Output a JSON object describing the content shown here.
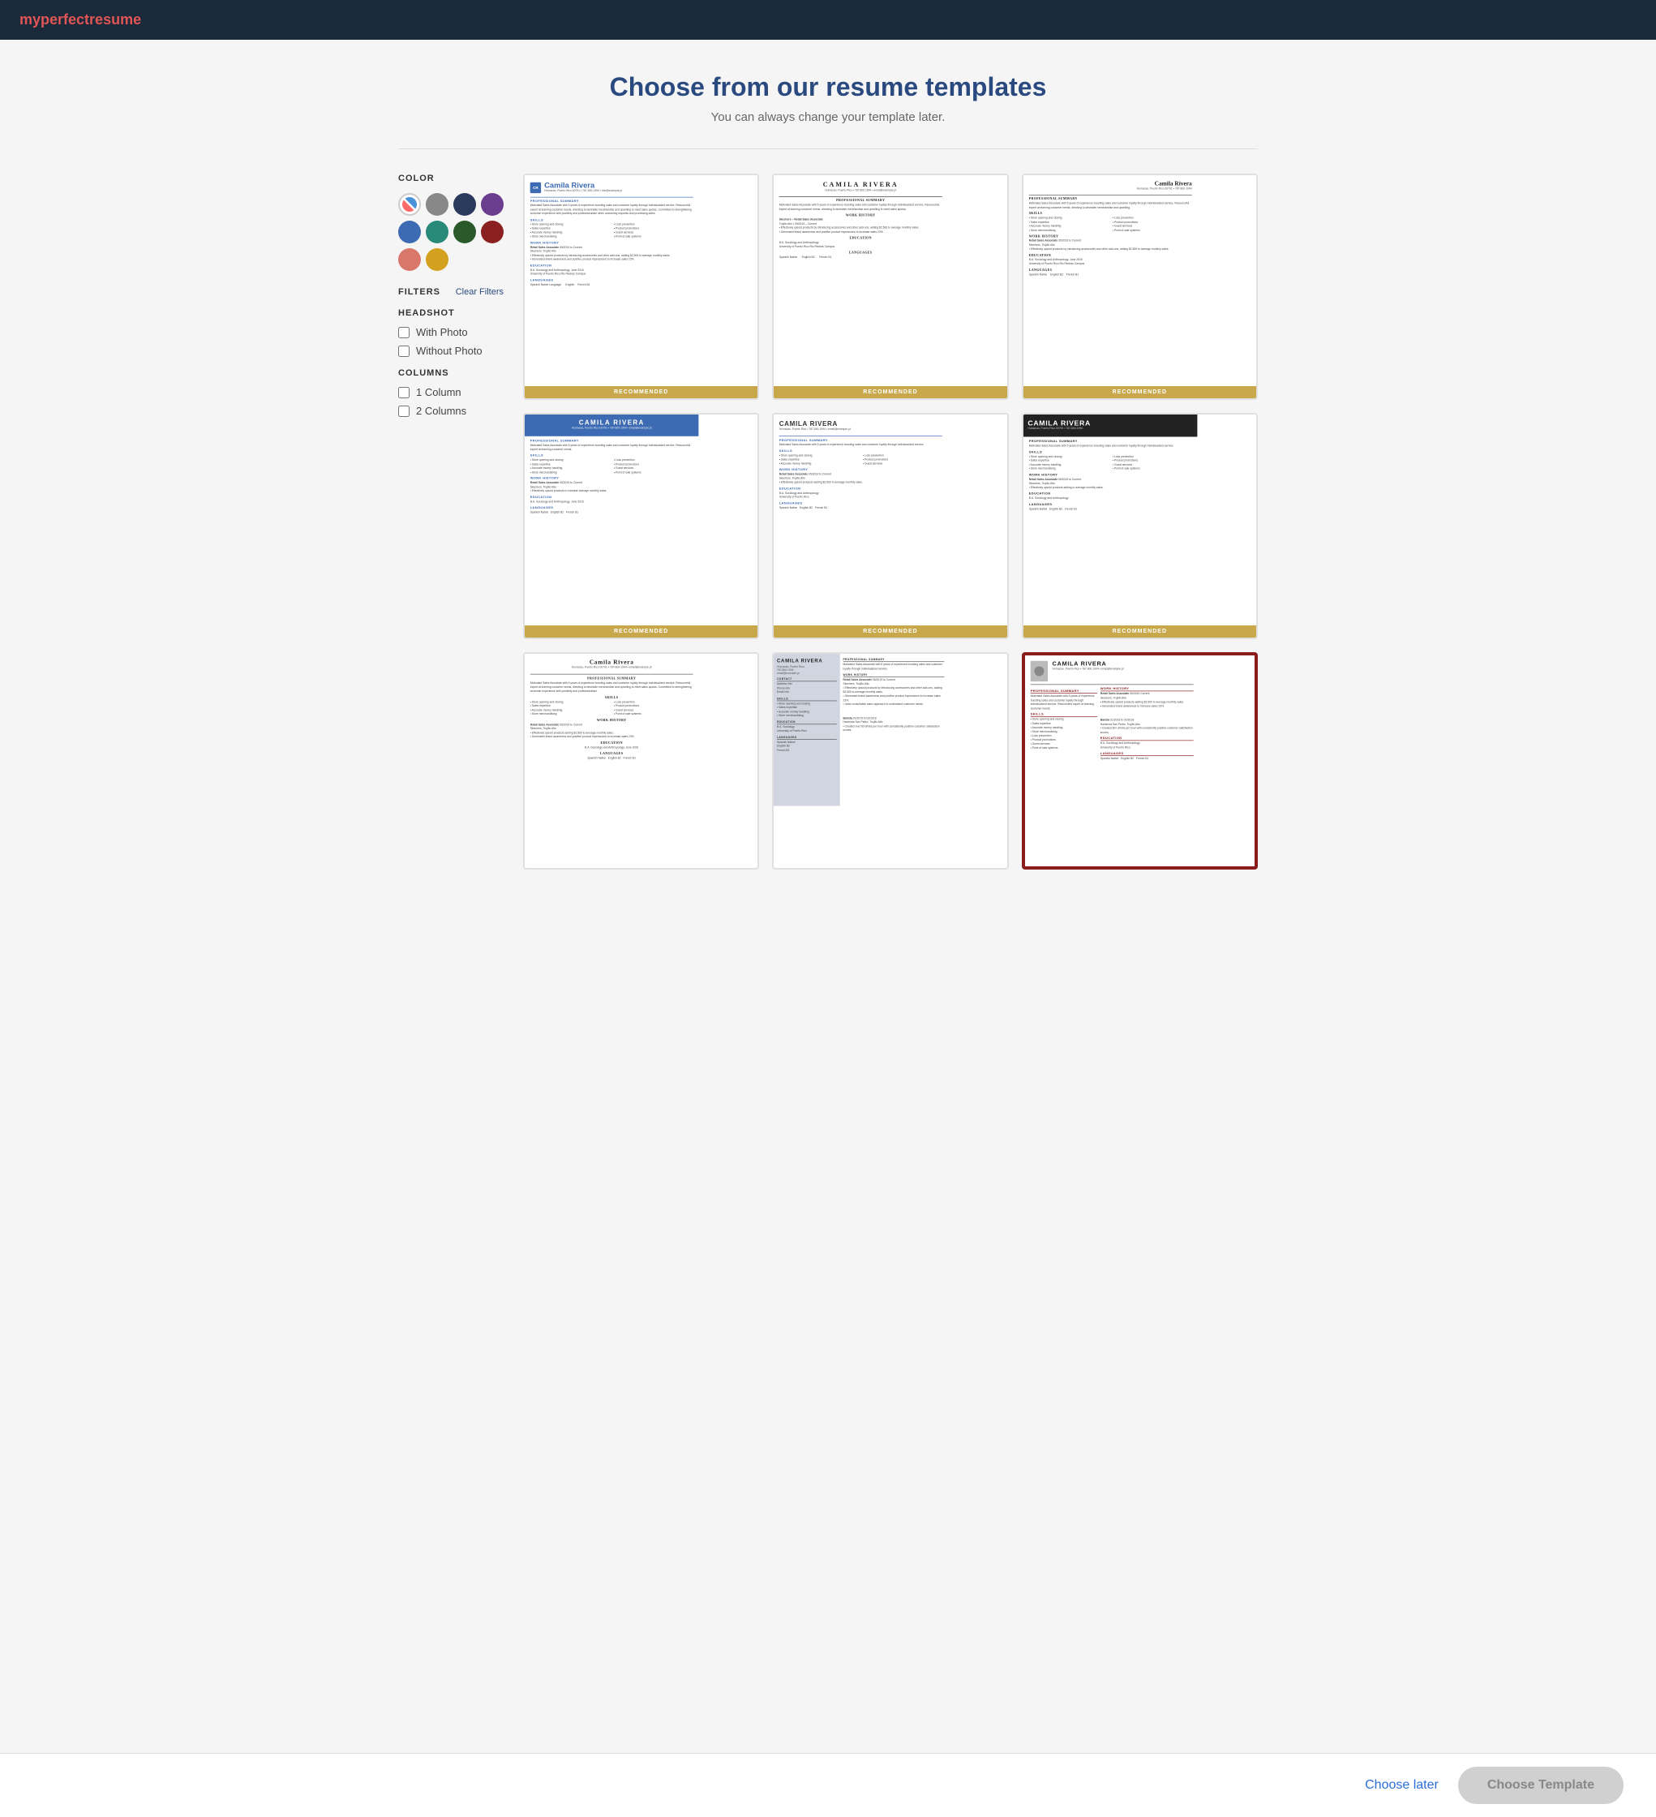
{
  "header": {
    "logo_prefix": "my",
    "logo_highlight": "perfect",
    "logo_suffix": "resume"
  },
  "page": {
    "title": "Choose from our resume templates",
    "subtitle": "You can always change your template later."
  },
  "sidebar": {
    "color_section_title": "COLOR",
    "filters_title": "FILTERS",
    "clear_filters_label": "Clear Filters",
    "headshot_title": "HEADSHOT",
    "with_photo_label": "With Photo",
    "without_photo_label": "Without Photo",
    "columns_title": "COLUMNS",
    "one_column_label": "1 Column",
    "two_columns_label": "2 Columns",
    "colors": [
      {
        "id": "rainbow",
        "value": "rainbow",
        "selected": true
      },
      {
        "id": "gray",
        "value": "#888888"
      },
      {
        "id": "darkblue",
        "value": "#2a3a5c"
      },
      {
        "id": "purple",
        "value": "#6b3d8f"
      },
      {
        "id": "blue",
        "value": "#3d6bb3"
      },
      {
        "id": "teal",
        "value": "#2a8a7a"
      },
      {
        "id": "darkgreen",
        "value": "#2a5a2a"
      },
      {
        "id": "darkred",
        "value": "#8b2020"
      },
      {
        "id": "salmon",
        "value": "#d9776a"
      },
      {
        "id": "gold",
        "value": "#d4a020"
      }
    ]
  },
  "templates": [
    {
      "id": 1,
      "style": "blue-left-accent",
      "recommended": true,
      "name": "Camila Rivera",
      "contact": "Humacao, Puerto Rico 00791 | 787-800-1994 | e: info@example.pt",
      "has_photo": false,
      "columns": 1
    },
    {
      "id": 2,
      "style": "centered-serif",
      "recommended": true,
      "name": "CAMILA RIVERA",
      "contact": "Humacao, Puerto Rico | 787.800.1994 | email@example.pt",
      "has_photo": false,
      "columns": 1
    },
    {
      "id": 3,
      "style": "classic-right",
      "recommended": true,
      "name": "Camila Rivera",
      "contact": "Humacao, Puerto Rico 00791 | 787-800-1994",
      "has_photo": false,
      "columns": 1
    },
    {
      "id": 4,
      "style": "blue-bar-header",
      "recommended": true,
      "name": "CAMILA RIVERA",
      "contact": "Humacao, Puerto Rico 00791 | 787-800-1994 | email@example.pt",
      "has_photo": false,
      "columns": 1
    },
    {
      "id": 5,
      "style": "minimal-centered",
      "recommended": true,
      "name": "CAMILA RIVERA",
      "contact": "Humacao, Puerto Rico | 787.800.1994 | email@example.pt",
      "has_photo": false,
      "columns": 1
    },
    {
      "id": 6,
      "style": "dark-header",
      "recommended": true,
      "name": "CAMILA RIVERA",
      "contact": "Humacao, Puerto Rico 00791 | 787-800-1994",
      "has_photo": false,
      "columns": 1
    },
    {
      "id": 7,
      "style": "simple-classic",
      "recommended": false,
      "name": "Camila Rivera",
      "contact": "Humacao, Puerto Rico 00791 | 787-800-1994 | email@example.pt",
      "has_photo": false,
      "columns": 1
    },
    {
      "id": 8,
      "style": "two-column-sidebar",
      "recommended": false,
      "name": "CAMILA RIVERA",
      "contact": "Humacao, Puerto Rico | 787.800.1994",
      "has_photo": false,
      "columns": 2
    },
    {
      "id": 9,
      "style": "photo-red-border",
      "recommended": false,
      "name": "CAMILA RIVERA",
      "contact": "Humacao, Puerto Rico | 787.800.1994",
      "has_photo": true,
      "columns": 2
    }
  ],
  "bottom_bar": {
    "choose_later_label": "Choose later",
    "choose_template_label": "Choose Template"
  }
}
